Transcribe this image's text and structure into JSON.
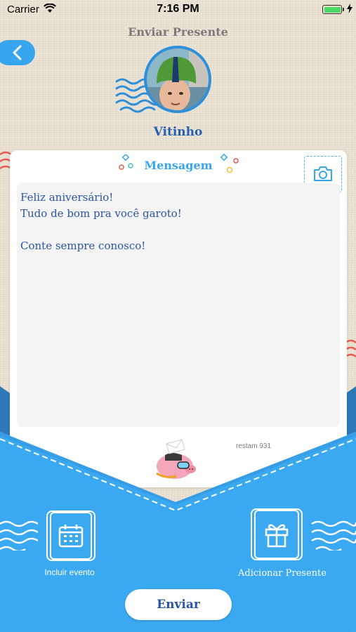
{
  "status_bar": {
    "carrier": "Carrier",
    "time": "7:16 PM",
    "battery_level": 1.0
  },
  "header": {
    "title": "Enviar Presente",
    "back_icon": "chevron-left-icon"
  },
  "recipient": {
    "name": "Vitinho",
    "avatar": "child-avatar-photo"
  },
  "card": {
    "title": "Mensagem",
    "camera_icon": "camera-icon",
    "message": "Feliz aniversário!\nTudo de bom pra você garoto!\n\nConte sempre conosco!",
    "remaining": "restam 931"
  },
  "actions": {
    "event_label": "Incluir evento",
    "event_icon": "calendar-icon",
    "gift_label": "Adicionar Presente",
    "gift_icon": "gift-icon",
    "send_label": "Enviar"
  },
  "colors": {
    "accent": "#38a6ee",
    "envelope": "#3aa9f2",
    "text_blue": "#2a55a6",
    "title_gray": "#7b7b7b"
  }
}
